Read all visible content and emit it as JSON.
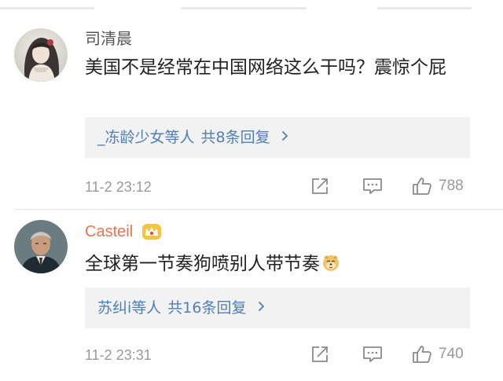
{
  "comments": [
    {
      "username": "司清晨",
      "text": "美国不是经常在中国网络这么干吗？震惊个屁",
      "reply_users": "_冻龄少女",
      "reply_connector": "等人",
      "reply_count": "共8条回复",
      "time": "11-2 23:12",
      "likes": "788",
      "avatar_icon": "anime-woman-avatar"
    },
    {
      "username": "Casteil",
      "text": "全球第一节奏狗喷别人带节奏",
      "reply_users": "苏纠i",
      "reply_connector": "等人",
      "reply_count": "共16条回复",
      "time": "11-2 23:31",
      "likes": "740",
      "avatar_icon": "man-portrait-avatar",
      "badge_icon": "crown-icon",
      "emoji_icon": "doge-emoji"
    }
  ],
  "colors": {
    "username": "#555555",
    "vip_username": "#eb7350",
    "link": "#4f7fb3",
    "meta": "#999999",
    "reply_bg": "#f2f2f2"
  }
}
